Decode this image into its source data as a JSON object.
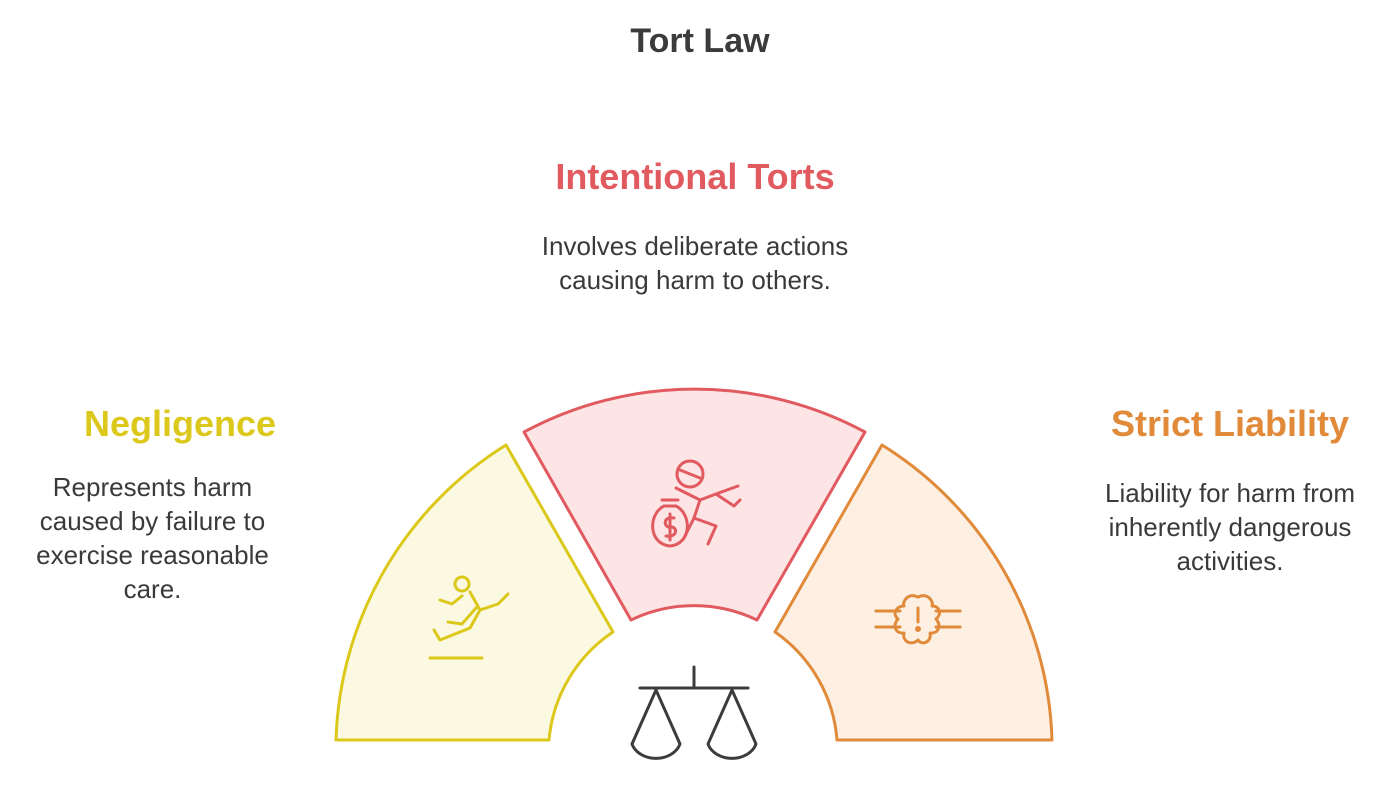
{
  "title": "Tort Law",
  "segments": {
    "intentional": {
      "heading": "Intentional Torts",
      "description": "Involves deliberate actions causing harm to others.",
      "color": "#e15a5f",
      "fill": "#fde4e5",
      "icon": "running-thief-money-bag-icon"
    },
    "negligence": {
      "heading": "Negligence",
      "description": "Represents harm caused by failure to exercise reasonable care.",
      "color": "#dcc81a",
      "fill": "#fcf9e2",
      "icon": "slipping-person-icon"
    },
    "strict": {
      "heading": "Strict Liability",
      "description": "Liability for harm from inherently dangerous activities.",
      "color": "#e08a3a",
      "fill": "#fdf0e3",
      "icon": "hazard-pipe-icon"
    }
  },
  "center_icon": "scales-of-justice-icon"
}
